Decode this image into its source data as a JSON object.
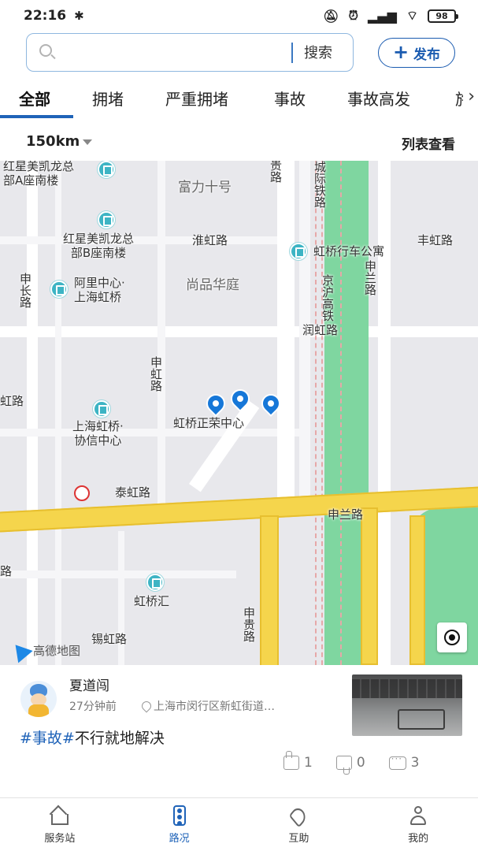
{
  "status_bar": {
    "time": "22:16",
    "bluetooth_icon": "bluetooth-icon",
    "battery": "98"
  },
  "search": {
    "placeholder": "",
    "value": "",
    "button_label": "搜索"
  },
  "publish": {
    "label": "发布"
  },
  "tabs": [
    {
      "label": "全部",
      "active": true
    },
    {
      "label": "拥堵",
      "active": false
    },
    {
      "label": "严重拥堵",
      "active": false
    },
    {
      "label": "事故",
      "active": false
    },
    {
      "label": "事故高发",
      "active": false
    },
    {
      "label": "施",
      "active": false
    }
  ],
  "filter": {
    "distance": "150km",
    "list_view_label": "列表查看"
  },
  "map": {
    "labels": {
      "hongxing_a": "红星美凯龙总\n部A座南楼",
      "fuli": "富力十号",
      "tonggui_top": "贵路",
      "chengji_rail": "城际铁路",
      "hongxing_b": "红星美凯龙总\n部B座南楼",
      "huaihong": "淮虹路",
      "hongqiao_apartment": "虹桥行车公寓",
      "fenghong": "丰虹路",
      "shenzhang": "申长路",
      "alibaba": "阿里中心·\n上海虹桥",
      "shangpin": "尚品华庭",
      "jinghu_rail": "京沪高铁",
      "shenlan_v": "申兰路",
      "runhong": "润虹路",
      "shenhong": "申虹路",
      "hong_left": "虹路",
      "hongqiao_zhengrong": "虹桥正荣中心",
      "xiexin": "上海虹桥·\n协信中心",
      "taihong": "泰虹路",
      "shenlan_h": "申兰路",
      "lu_left": "路",
      "hongqiao_hui": "虹桥汇",
      "shengui": "申贵路",
      "xihong": "锡虹路",
      "amap_logo": "高德地图"
    }
  },
  "post": {
    "user_name": "夏道闯",
    "time": "27分钟前",
    "location": "上海市闵行区新虹街道…",
    "tag": "#事故#",
    "text": "不行就地解决",
    "likes": "1",
    "dislikes": "0",
    "comments": "3"
  },
  "bottom_nav": [
    {
      "label": "服务站",
      "icon": "home-icon",
      "active": false
    },
    {
      "label": "路况",
      "icon": "traffic-light-icon",
      "active": true
    },
    {
      "label": "互助",
      "icon": "handshake-heart-icon",
      "active": false
    },
    {
      "label": "我的",
      "icon": "person-icon",
      "active": false
    }
  ],
  "colors": {
    "accent": "#1f63b8",
    "map_bg": "#e8e8ec",
    "road_major": "#f5d54c",
    "green_belt": "#7fd6a0",
    "pin": "#1677d8"
  }
}
